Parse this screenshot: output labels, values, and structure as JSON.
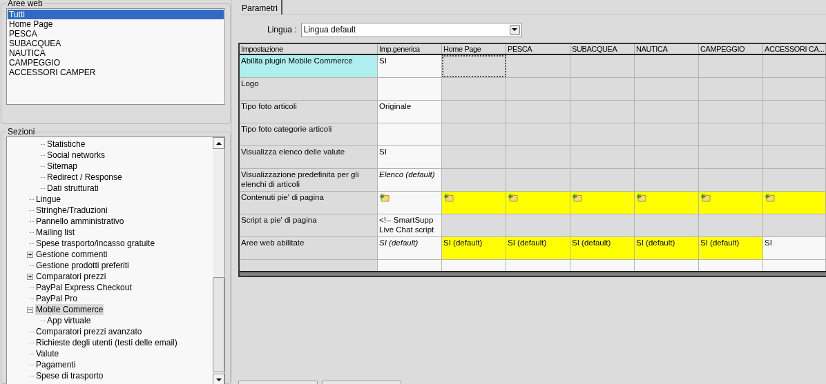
{
  "web_areas": {
    "legend": "Aree web",
    "items": [
      {
        "label": "Tutti",
        "selected": true
      },
      {
        "label": "Home Page",
        "selected": false
      },
      {
        "label": "PESCA",
        "selected": false
      },
      {
        "label": "SUBACQUEA",
        "selected": false
      },
      {
        "label": "NAUTICA",
        "selected": false
      },
      {
        "label": "CAMPEGGIO",
        "selected": false
      },
      {
        "label": "ACCESSORI CAMPER",
        "selected": false
      }
    ]
  },
  "sections": {
    "legend": "Sezioni",
    "continued_children": [
      {
        "label": "Statistiche",
        "selected": false
      },
      {
        "label": "Social networks",
        "selected": false
      },
      {
        "label": "Sitemap",
        "selected": false
      },
      {
        "label": "Redirect / Response",
        "selected": false
      },
      {
        "label": "Dati strutturati",
        "selected": false
      }
    ],
    "items": [
      {
        "label": "Lingue",
        "selected": false
      },
      {
        "label": "Stringhe/Traduzioni",
        "selected": false
      },
      {
        "label": "Pannello amministrativo",
        "selected": false
      },
      {
        "label": "Mailing list",
        "selected": false
      },
      {
        "label": "Spese trasporto/incasso gratuite",
        "selected": false
      },
      {
        "label": "Gestione commenti",
        "selected": false,
        "expanded": false
      },
      {
        "label": "Gestione prodotti preferiti",
        "selected": false
      },
      {
        "label": "Comparatori prezzi",
        "selected": false,
        "expanded": false
      },
      {
        "label": "PayPal Express Checkout",
        "selected": false
      },
      {
        "label": "PayPal Pro",
        "selected": false
      },
      {
        "label": "Mobile Commerce",
        "selected": true,
        "expanded": true,
        "children": [
          {
            "label": "App virtuale",
            "selected": false
          }
        ]
      },
      {
        "label": "Comparatori prezzi avanzato",
        "selected": false
      },
      {
        "label": "Richieste degli utenti (testi delle email)",
        "selected": false
      },
      {
        "label": "Valute",
        "selected": false
      },
      {
        "label": "Pagamenti",
        "selected": false
      },
      {
        "label": "Spese di trasporto",
        "selected": false
      }
    ]
  },
  "tabs": [
    {
      "label": "Parametri",
      "selected": true
    }
  ],
  "language": {
    "label": "Lingua :",
    "value": "Lingua default"
  },
  "table": {
    "columns": [
      "Impostazione",
      "Imp.generica",
      "Home Page",
      "PESCA",
      "SUBACQUEA",
      "NAUTICA",
      "CAMPEGGIO",
      "ACCESSORI CA..."
    ],
    "rows": [
      {
        "selected": true,
        "cells": [
          {
            "kind": "label",
            "text": "Abilita plugin Mobile Commerce"
          },
          {
            "kind": "text",
            "inherited": false,
            "highlighted": false,
            "text": "SI",
            "italic": false,
            "focused": false
          },
          {
            "kind": "empty",
            "inherited": true,
            "highlighted": false,
            "focused": true
          },
          {
            "kind": "empty",
            "inherited": true,
            "highlighted": false,
            "focused": false
          },
          {
            "kind": "empty",
            "inherited": true,
            "highlighted": false,
            "focused": false
          },
          {
            "kind": "empty",
            "inherited": true,
            "highlighted": false,
            "focused": false
          },
          {
            "kind": "empty",
            "inherited": true,
            "highlighted": false,
            "focused": false
          },
          {
            "kind": "empty",
            "inherited": true,
            "highlighted": false,
            "focused": false
          }
        ]
      },
      {
        "selected": false,
        "cells": [
          {
            "kind": "label",
            "text": "Logo"
          },
          {
            "kind": "empty",
            "inherited": false,
            "highlighted": false,
            "focused": false
          },
          {
            "kind": "empty",
            "inherited": true,
            "highlighted": false,
            "focused": false
          },
          {
            "kind": "empty",
            "inherited": true,
            "highlighted": false,
            "focused": false
          },
          {
            "kind": "empty",
            "inherited": true,
            "highlighted": false,
            "focused": false
          },
          {
            "kind": "empty",
            "inherited": true,
            "highlighted": false,
            "focused": false
          },
          {
            "kind": "empty",
            "inherited": true,
            "highlighted": false,
            "focused": false
          },
          {
            "kind": "empty",
            "inherited": true,
            "highlighted": false,
            "focused": false
          }
        ]
      },
      {
        "selected": false,
        "cells": [
          {
            "kind": "label",
            "text": "Tipo foto articoli"
          },
          {
            "kind": "text",
            "inherited": false,
            "highlighted": false,
            "text": "Originale",
            "italic": false,
            "focused": false
          },
          {
            "kind": "empty",
            "inherited": true,
            "highlighted": false,
            "focused": false
          },
          {
            "kind": "empty",
            "inherited": true,
            "highlighted": false,
            "focused": false
          },
          {
            "kind": "empty",
            "inherited": true,
            "highlighted": false,
            "focused": false
          },
          {
            "kind": "empty",
            "inherited": true,
            "highlighted": false,
            "focused": false
          },
          {
            "kind": "empty",
            "inherited": true,
            "highlighted": false,
            "focused": false
          },
          {
            "kind": "empty",
            "inherited": true,
            "highlighted": false,
            "focused": false
          }
        ]
      },
      {
        "selected": false,
        "cells": [
          {
            "kind": "label",
            "text": "Tipo foto categorie articoli"
          },
          {
            "kind": "empty",
            "inherited": false,
            "highlighted": false,
            "focused": false
          },
          {
            "kind": "empty",
            "inherited": true,
            "highlighted": false,
            "focused": false
          },
          {
            "kind": "empty",
            "inherited": true,
            "highlighted": false,
            "focused": false
          },
          {
            "kind": "empty",
            "inherited": true,
            "highlighted": false,
            "focused": false
          },
          {
            "kind": "empty",
            "inherited": true,
            "highlighted": false,
            "focused": false
          },
          {
            "kind": "empty",
            "inherited": true,
            "highlighted": false,
            "focused": false
          },
          {
            "kind": "empty",
            "inherited": true,
            "highlighted": false,
            "focused": false
          }
        ]
      },
      {
        "selected": false,
        "cells": [
          {
            "kind": "label",
            "text": "Visualizza elenco delle valute"
          },
          {
            "kind": "text",
            "inherited": false,
            "highlighted": false,
            "text": "SI",
            "italic": false,
            "focused": false
          },
          {
            "kind": "empty",
            "inherited": true,
            "highlighted": false,
            "focused": false
          },
          {
            "kind": "empty",
            "inherited": true,
            "highlighted": false,
            "focused": false
          },
          {
            "kind": "empty",
            "inherited": true,
            "highlighted": false,
            "focused": false
          },
          {
            "kind": "empty",
            "inherited": true,
            "highlighted": false,
            "focused": false
          },
          {
            "kind": "empty",
            "inherited": true,
            "highlighted": false,
            "focused": false
          },
          {
            "kind": "empty",
            "inherited": true,
            "highlighted": false,
            "focused": false
          }
        ]
      },
      {
        "selected": false,
        "cells": [
          {
            "kind": "label",
            "text": "Visualizzazione predefinita per gli elenchi di articoli"
          },
          {
            "kind": "text",
            "inherited": false,
            "highlighted": false,
            "text": "Elenco (default)",
            "italic": true,
            "focused": false
          },
          {
            "kind": "empty",
            "inherited": true,
            "highlighted": false,
            "focused": false
          },
          {
            "kind": "empty",
            "inherited": true,
            "highlighted": false,
            "focused": false
          },
          {
            "kind": "empty",
            "inherited": true,
            "highlighted": false,
            "focused": false
          },
          {
            "kind": "empty",
            "inherited": true,
            "highlighted": false,
            "focused": false
          },
          {
            "kind": "empty",
            "inherited": true,
            "highlighted": false,
            "focused": false
          },
          {
            "kind": "empty",
            "inherited": true,
            "highlighted": false,
            "focused": false
          }
        ]
      },
      {
        "selected": false,
        "cells": [
          {
            "kind": "label",
            "text": "Contenuti pie' di pagina"
          },
          {
            "kind": "folder",
            "inherited": false,
            "highlighted": false,
            "focused": false
          },
          {
            "kind": "folder",
            "inherited": false,
            "highlighted": true,
            "focused": false
          },
          {
            "kind": "folder",
            "inherited": false,
            "highlighted": true,
            "focused": false
          },
          {
            "kind": "folder",
            "inherited": false,
            "highlighted": true,
            "focused": false
          },
          {
            "kind": "folder",
            "inherited": false,
            "highlighted": true,
            "focused": false
          },
          {
            "kind": "folder",
            "inherited": false,
            "highlighted": true,
            "focused": false
          },
          {
            "kind": "folder",
            "inherited": false,
            "highlighted": true,
            "focused": false
          }
        ]
      },
      {
        "selected": false,
        "cells": [
          {
            "kind": "label",
            "text": "Script a pie' di pagina"
          },
          {
            "kind": "text",
            "inherited": false,
            "highlighted": false,
            "text": "<!-- SmartSupp Live Chat script",
            "italic": false,
            "focused": false
          },
          {
            "kind": "empty",
            "inherited": true,
            "highlighted": false,
            "focused": false
          },
          {
            "kind": "empty",
            "inherited": true,
            "highlighted": false,
            "focused": false
          },
          {
            "kind": "empty",
            "inherited": true,
            "highlighted": false,
            "focused": false
          },
          {
            "kind": "empty",
            "inherited": true,
            "highlighted": false,
            "focused": false
          },
          {
            "kind": "empty",
            "inherited": true,
            "highlighted": false,
            "focused": false
          },
          {
            "kind": "empty",
            "inherited": true,
            "highlighted": false,
            "focused": false
          }
        ]
      },
      {
        "selected": false,
        "cells": [
          {
            "kind": "label",
            "text": "Aree web abilitate"
          },
          {
            "kind": "text",
            "inherited": false,
            "highlighted": false,
            "text": "SI (default)",
            "italic": true,
            "focused": false
          },
          {
            "kind": "text",
            "inherited": false,
            "highlighted": true,
            "text": "SI (default)",
            "italic": false,
            "focused": false
          },
          {
            "kind": "text",
            "inherited": false,
            "highlighted": true,
            "text": "SI (default)",
            "italic": false,
            "focused": false
          },
          {
            "kind": "text",
            "inherited": false,
            "highlighted": true,
            "text": "SI (default)",
            "italic": false,
            "focused": false
          },
          {
            "kind": "text",
            "inherited": false,
            "highlighted": true,
            "text": "SI (default)",
            "italic": false,
            "focused": false
          },
          {
            "kind": "text",
            "inherited": false,
            "highlighted": true,
            "text": "SI (default)",
            "italic": false,
            "focused": false
          },
          {
            "kind": "text",
            "inherited": false,
            "highlighted": false,
            "text": "SI",
            "italic": false,
            "focused": false
          }
        ]
      }
    ]
  }
}
